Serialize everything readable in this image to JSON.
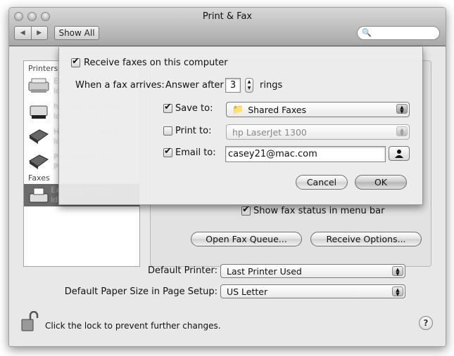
{
  "window": {
    "title": "Print & Fax",
    "nav": {
      "back_icon": "◀",
      "forward_icon": "▶"
    },
    "show_all_label": "Show All",
    "search": {
      "placeholder": "",
      "value": ""
    }
  },
  "sidebar": {
    "printers_header": "Printers",
    "printers": [
      {
        "name": "Eastman Kodak",
        "status": "Idle"
      },
      {
        "name": "hp LaserJet 1300",
        "status": "Idle, Default"
      },
      {
        "name": "HP Photosmart 8...",
        "status": "Idle"
      },
      {
        "name": "Photosmart 820...",
        "status": "Paused"
      }
    ],
    "faxes_header": "Faxes",
    "faxes": [
      {
        "name": "External Modem",
        "status": "Idle"
      }
    ]
  },
  "sheet": {
    "receive_faxes_label": "Receive faxes on this computer",
    "receive_faxes_checked": true,
    "when_fax_arrives_label": "When a fax arrives:",
    "answer_after_label": "Answer after",
    "rings_value": "3",
    "rings_label": "rings",
    "save_to": {
      "label": "Save to:",
      "checked": true,
      "value": "Shared Faxes"
    },
    "print_to": {
      "label": "Print to:",
      "checked": false,
      "value": "hp LaserJet 1300"
    },
    "email_to": {
      "label": "Email to:",
      "checked": true,
      "value": "casey21@mac.com"
    },
    "cancel_label": "Cancel",
    "ok_label": "OK"
  },
  "panel": {
    "show_fax_status_label": "Show fax status in menu bar",
    "show_fax_status_checked": true,
    "open_fax_queue_label": "Open Fax Queue...",
    "receive_options_label": "Receive Options..."
  },
  "defaults": {
    "default_printer_label": "Default Printer:",
    "default_printer_value": "Last Printer Used",
    "paper_size_label": "Default Paper Size in Page Setup:",
    "paper_size_value": "US Letter"
  },
  "footer": {
    "lock_text": "Click the lock to prevent further changes.",
    "help_label": "?"
  }
}
